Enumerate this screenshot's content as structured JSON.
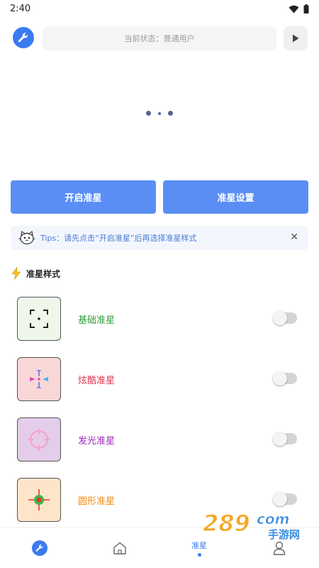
{
  "status_bar": {
    "time": "2:40",
    "icons": [
      "wifi-icon",
      "battery-icon"
    ]
  },
  "top_bar": {
    "status_text": "当前状态：普通用户",
    "tool_icon": "wrench-icon",
    "play_icon": "play-icon"
  },
  "carousel": {
    "pages": 3,
    "active_index": 0
  },
  "actions": {
    "open_label": "开启准星",
    "settings_label": "准星设置"
  },
  "tips": {
    "text": "Tips：请先点击“开启准星”后再选择准星样式",
    "close_label": "✕"
  },
  "section": {
    "title": "准星样式"
  },
  "styles": [
    {
      "label": "基础准星",
      "color": "#2f9b3a",
      "bg": "#eff6ea",
      "enabled": false
    },
    {
      "label": "炫酷准星",
      "color": "#e0334f",
      "bg": "#f9d7d7",
      "enabled": false
    },
    {
      "label": "发光准星",
      "color": "#9b28b8",
      "bg": "#e3cdea",
      "enabled": false
    },
    {
      "label": "圆形准星",
      "color": "#f08a17",
      "bg": "#fde5c9",
      "enabled": false
    }
  ],
  "bottom_nav": {
    "items": [
      {
        "name": "tools",
        "icon": "wrench-icon"
      },
      {
        "name": "home",
        "icon": "home-icon"
      },
      {
        "name": "crosshair",
        "label": "准星",
        "active": true
      },
      {
        "name": "profile",
        "icon": "user-icon"
      }
    ]
  },
  "colors": {
    "accent": "#3a7bf0",
    "button": "#5b8ef5",
    "tips_bg": "#f3f7fd"
  },
  "watermark": {
    "text_main": "289",
    "text_suffix": "com",
    "text_sub": "手游网"
  }
}
